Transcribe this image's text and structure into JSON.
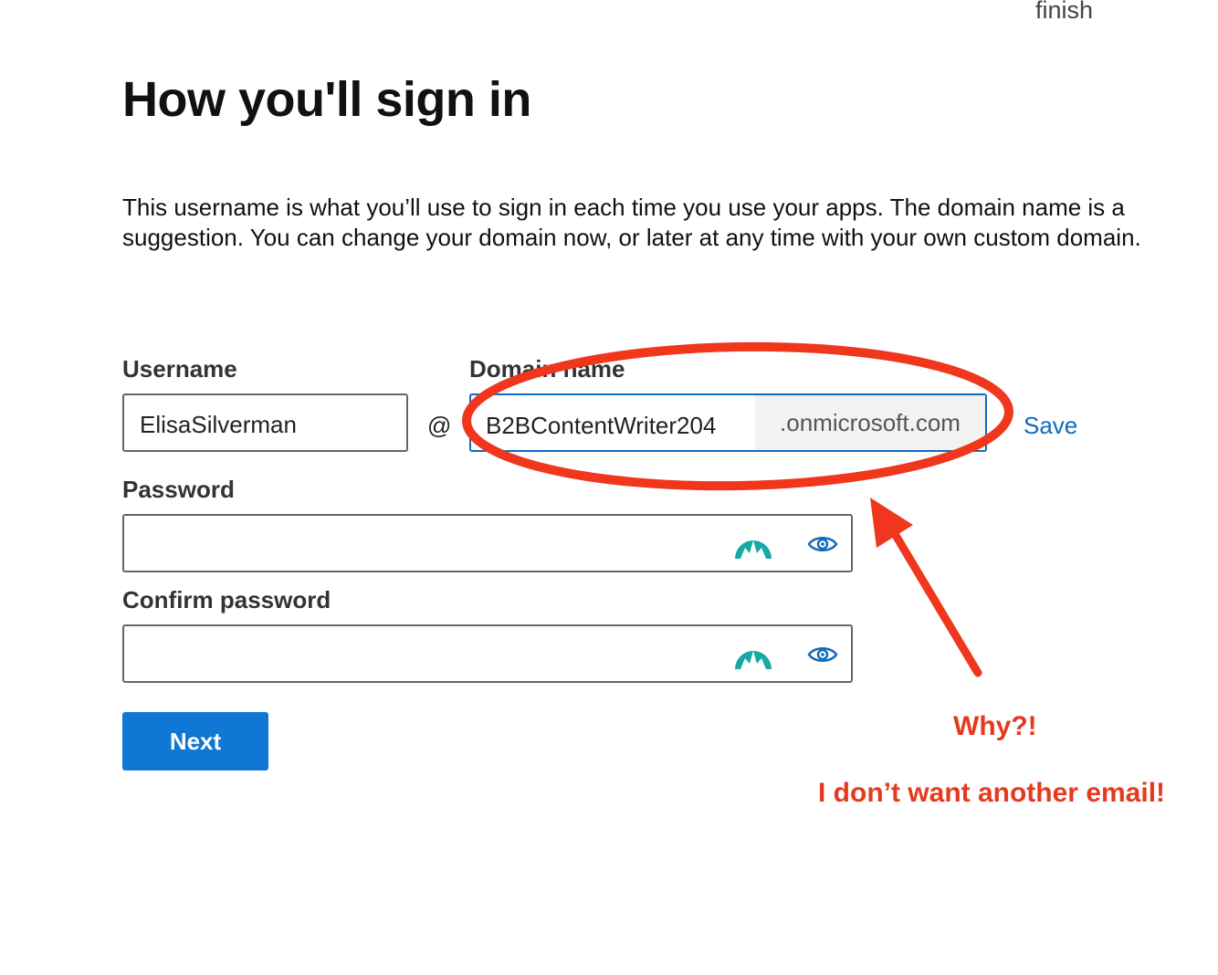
{
  "header": {
    "step_text": "finish"
  },
  "page": {
    "title": "How you'll sign in",
    "description": "This username is what you’ll use to sign in each time you use your apps. The domain name is a suggestion. You can change your domain now, or later at any time with your own custom domain."
  },
  "form": {
    "username_label": "Username",
    "username_value": "ElisaSilverman",
    "at_symbol": "@",
    "domain_label": "Domain name",
    "domain_value": "B2BContentWriter204",
    "domain_suffix": ".onmicrosoft.com",
    "save_label": "Save",
    "password_label": "Password",
    "confirm_password_label": "Confirm password",
    "next_label": "Next"
  },
  "annotations": {
    "why": "Why?!",
    "complaint": "I don’t want another email!",
    "color": "#e53a1e"
  },
  "icons": {
    "password_manager": "nordpass-mountain-icon",
    "reveal": "eye-icon"
  }
}
